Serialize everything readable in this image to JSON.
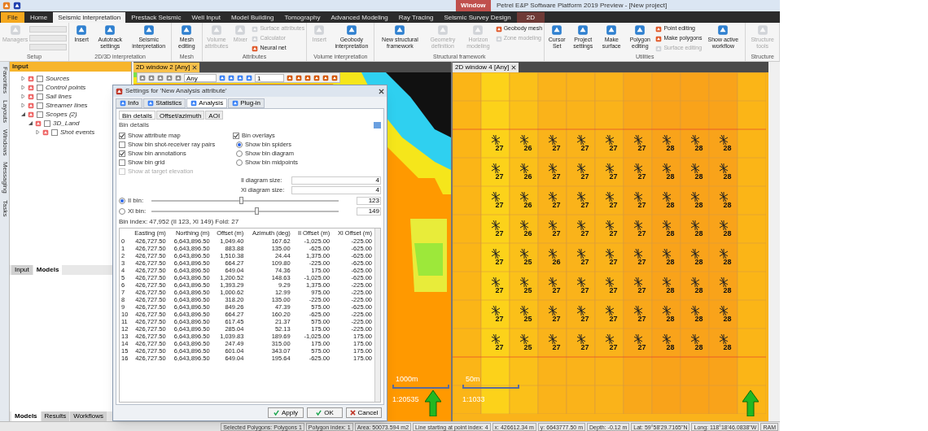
{
  "title_bar": {
    "title": "Petrel E&P Software Platform 2019 Preview - [New project]",
    "context_label": "Window"
  },
  "menu_tabs": [
    {
      "label": "File",
      "selected": false,
      "kind": "file"
    },
    {
      "label": "Home",
      "selected": false,
      "kind": "tab"
    },
    {
      "label": "Seismic interpretation",
      "selected": true,
      "kind": "tab"
    },
    {
      "label": "Prestack Seismic",
      "selected": false,
      "kind": "tab"
    },
    {
      "label": "Well Input",
      "selected": false,
      "kind": "tab"
    },
    {
      "label": "Model Building",
      "selected": false,
      "kind": "tab"
    },
    {
      "label": "Tomography",
      "selected": false,
      "kind": "tab"
    },
    {
      "label": "Advanced Modeling",
      "selected": false,
      "kind": "tab"
    },
    {
      "label": "Ray Tracing",
      "selected": false,
      "kind": "tab"
    },
    {
      "label": "Seismic Survey Design",
      "selected": false,
      "kind": "tab"
    },
    {
      "label": "2D",
      "selected": false,
      "kind": "context"
    }
  ],
  "ribbon_groups": [
    {
      "label": "Setup",
      "items": [
        {
          "kind": "large",
          "label": "Managers",
          "disabled": true
        },
        {
          "kind": "combos"
        }
      ]
    },
    {
      "label": "2D/3D interpretation",
      "items": [
        {
          "kind": "large",
          "label": "Insert",
          "disabled": false
        },
        {
          "kind": "large",
          "label": "Autotrack settings",
          "disabled": false
        },
        {
          "kind": "large",
          "label": "Seismic interpretation",
          "disabled": false
        }
      ]
    },
    {
      "label": "Mesh",
      "items": [
        {
          "kind": "large",
          "label": "Mesh editing",
          "disabled": false
        }
      ]
    },
    {
      "label": "Attributes",
      "items": [
        {
          "kind": "large",
          "label": "Volume attributes",
          "disabled": true
        },
        {
          "kind": "large",
          "label": "Mixer",
          "disabled": true
        },
        {
          "kind": "small",
          "label": "Surface attributes",
          "disabled": true
        },
        {
          "kind": "small",
          "label": "Calculator",
          "disabled": true
        },
        {
          "kind": "small",
          "label": "Neural net",
          "disabled": false
        }
      ]
    },
    {
      "label": "Volume interpretation",
      "items": [
        {
          "kind": "large",
          "label": "Insert",
          "disabled": true
        },
        {
          "kind": "large",
          "label": "Geobody interpretation",
          "disabled": false
        }
      ]
    },
    {
      "label": "Structural framework",
      "items": [
        {
          "kind": "large",
          "label": "New structural framework",
          "disabled": false
        },
        {
          "kind": "large",
          "label": "Geometry definition",
          "disabled": true
        },
        {
          "kind": "large",
          "label": "Horizon modeling",
          "disabled": true
        },
        {
          "kind": "small",
          "label": "Geobody mesh",
          "disabled": false
        },
        {
          "kind": "small",
          "label": "Zone modeling",
          "disabled": true
        }
      ]
    },
    {
      "label": "Utilities",
      "items": [
        {
          "kind": "large",
          "label": "Cursor Set",
          "disabled": false
        },
        {
          "kind": "large",
          "label": "Project settings",
          "disabled": false
        },
        {
          "kind": "large",
          "label": "Make surface",
          "disabled": false
        },
        {
          "kind": "large",
          "label": "Polygon editing",
          "disabled": false
        },
        {
          "kind": "small",
          "label": "Point editing",
          "disabled": false
        },
        {
          "kind": "small",
          "label": "Make polygons",
          "disabled": false
        },
        {
          "kind": "small",
          "label": "Surface editing",
          "disabled": true
        },
        {
          "kind": "large",
          "label": "Show active workflow",
          "disabled": false
        }
      ]
    },
    {
      "label": "Structure",
      "items": [
        {
          "kind": "large",
          "label": "Structure tools",
          "disabled": true
        }
      ]
    }
  ],
  "sidebar_strip": [
    "Favorites",
    "Layouts",
    "Windows",
    "Messaging",
    "Tasks"
  ],
  "input_panel": {
    "title": "Input",
    "tree": [
      {
        "label": "Sources",
        "expanded": false,
        "checked": false
      },
      {
        "label": "Control points",
        "expanded": false,
        "checked": false
      },
      {
        "label": "Sail lines",
        "expanded": false,
        "checked": false
      },
      {
        "label": "Streamer lines",
        "expanded": false,
        "checked": false
      },
      {
        "label": "Scopes (2)",
        "expanded": true,
        "checked": false,
        "children": [
          {
            "label": "3D_Land",
            "expanded": true,
            "checked": false,
            "children": [
              {
                "label": "Shot events",
                "expanded": false,
                "checked": false
              }
            ]
          }
        ]
      }
    ]
  },
  "panel_tabs": [
    {
      "label": "Input",
      "selected": false
    },
    {
      "label": "Models",
      "selected": true
    }
  ],
  "bottom_tabs": [
    {
      "label": "Models",
      "selected": true
    },
    {
      "label": "Results",
      "selected": false
    },
    {
      "label": "Workflows",
      "selected": false
    }
  ],
  "windows": [
    {
      "title": "2D window 2 [Any]",
      "selected": true,
      "domain": "Any",
      "zoom": "1",
      "scale_bar": "1000m",
      "scale": "1:20535"
    },
    {
      "title": "2D window 4 [Any]",
      "selected": false,
      "scale_bar": "50m",
      "scale": "1:1033",
      "bin_labels": [
        [
          "27",
          "26",
          "27",
          "27",
          "27",
          "27",
          "28",
          "28",
          "28"
        ],
        [
          "27",
          "26",
          "27",
          "27",
          "27",
          "27",
          "28",
          "28",
          "28"
        ],
        [
          "27",
          "26",
          "27",
          "27",
          "27",
          "27",
          "28",
          "28",
          "28"
        ],
        [
          "27",
          "26",
          "27",
          "27",
          "27",
          "27",
          "28",
          "28",
          "28"
        ],
        [
          "27",
          "25",
          "26",
          "27",
          "27",
          "27",
          "28",
          "28",
          "28"
        ],
        [
          "27",
          "25",
          "27",
          "27",
          "27",
          "27",
          "28",
          "28",
          "28"
        ],
        [
          "27",
          "25",
          "27",
          "27",
          "27",
          "27",
          "28",
          "28",
          "28"
        ],
        [
          "27",
          "25",
          "27",
          "27",
          "27",
          "27",
          "28",
          "28",
          "28"
        ]
      ]
    }
  ],
  "dialog": {
    "title": "Settings for 'New Analysis attribute'",
    "tabs": [
      {
        "label": "Info",
        "selected": false
      },
      {
        "label": "Statistics",
        "selected": false
      },
      {
        "label": "Analysis",
        "selected": true
      },
      {
        "label": "Plug-in",
        "selected": false
      }
    ],
    "subtabs": [
      {
        "label": "Bin details",
        "selected": true
      },
      {
        "label": "Offset/azimuth",
        "selected": false
      },
      {
        "label": "AOI",
        "selected": false
      }
    ],
    "section": "Bin details",
    "checkboxes": [
      {
        "label": "Show attribute map",
        "checked": true,
        "disabled": false
      },
      {
        "label": "Show bin shot-receiver ray pairs",
        "checked": false,
        "disabled": false
      },
      {
        "label": "Show bin annotations",
        "checked": true,
        "disabled": false
      },
      {
        "label": "Show bin grid",
        "checked": false,
        "disabled": false
      },
      {
        "label": "Show at target elevation",
        "checked": false,
        "disabled": true
      }
    ],
    "overlays": {
      "label": "Bin overlays",
      "checked": true
    },
    "radios": [
      {
        "label": "Show bin spiders",
        "selected": true
      },
      {
        "label": "Show bin diagram",
        "selected": false
      },
      {
        "label": "Show bin midpoints",
        "selected": false
      }
    ],
    "fields": [
      {
        "label": "Il diagram size:",
        "value": "4"
      },
      {
        "label": "Xl diagram size:",
        "value": "4"
      }
    ],
    "sliders": [
      {
        "label": "Il bin:",
        "selected": true,
        "level": 0.47,
        "value": "123"
      },
      {
        "label": "Xl bin:",
        "selected": false,
        "level": 0.55,
        "value": "149"
      }
    ],
    "bin_index": "Bin index: 47,952 (Il 123, Xl 149) Fold: 27",
    "table": {
      "columns": [
        "Easting (m)",
        "Northing (m)",
        "Offset (m)",
        "Azimuth (deg)",
        "Il Offset (m)",
        "Xl Offset (m)"
      ],
      "rows": [
        {
          "index": "0",
          "cells": [
            "426,727.50",
            "6,643,896.50",
            "1,049.40",
            "167.62",
            "-1,025.00",
            "-225.00"
          ]
        },
        {
          "index": "1",
          "cells": [
            "426,727.50",
            "6,643,896.50",
            "883.88",
            "135.00",
            "-625.00",
            "-625.00"
          ]
        },
        {
          "index": "2",
          "cells": [
            "426,727.50",
            "6,643,896.50",
            "1,510.38",
            "24.44",
            "1,375.00",
            "-625.00"
          ]
        },
        {
          "index": "3",
          "cells": [
            "426,727.50",
            "6,643,896.50",
            "664.27",
            "109.80",
            "-225.00",
            "-625.00"
          ]
        },
        {
          "index": "4",
          "cells": [
            "426,727.50",
            "6,643,896.50",
            "649.04",
            "74.36",
            "175.00",
            "-625.00"
          ]
        },
        {
          "index": "5",
          "cells": [
            "426,727.50",
            "6,643,896.50",
            "1,200.52",
            "148.63",
            "-1,025.00",
            "-625.00"
          ]
        },
        {
          "index": "6",
          "cells": [
            "426,727.50",
            "6,643,896.50",
            "1,393.29",
            "9.29",
            "1,375.00",
            "-225.00"
          ]
        },
        {
          "index": "7",
          "cells": [
            "426,727.50",
            "6,643,896.50",
            "1,000.62",
            "12.99",
            "975.00",
            "-225.00"
          ]
        },
        {
          "index": "8",
          "cells": [
            "426,727.50",
            "6,643,896.50",
            "318.20",
            "135.00",
            "-225.00",
            "-225.00"
          ]
        },
        {
          "index": "9",
          "cells": [
            "426,727.50",
            "6,643,896.50",
            "849.26",
            "47.39",
            "575.00",
            "-625.00"
          ]
        },
        {
          "index": "10",
          "cells": [
            "426,727.50",
            "6,643,896.50",
            "664.27",
            "160.20",
            "-625.00",
            "-225.00"
          ]
        },
        {
          "index": "11",
          "cells": [
            "426,727.50",
            "6,643,896.50",
            "617.45",
            "21.37",
            "575.00",
            "-225.00"
          ]
        },
        {
          "index": "12",
          "cells": [
            "426,727.50",
            "6,643,896.50",
            "285.04",
            "52.13",
            "175.00",
            "-225.00"
          ]
        },
        {
          "index": "13",
          "cells": [
            "426,727.50",
            "6,643,896.50",
            "1,039.83",
            "189.69",
            "-1,025.00",
            "175.00"
          ]
        },
        {
          "index": "14",
          "cells": [
            "426,727.50",
            "6,643,896.50",
            "247.49",
            "315.00",
            "175.00",
            "175.00"
          ]
        },
        {
          "index": "15",
          "cells": [
            "426,727.50",
            "6,643,896.50",
            "601.04",
            "343.07",
            "575.00",
            "175.00"
          ]
        },
        {
          "index": "16",
          "cells": [
            "426,727.50",
            "6,643,896.50",
            "649.04",
            "195.64",
            "-625.00",
            "175.00"
          ]
        }
      ]
    },
    "buttons": [
      {
        "label": "Apply",
        "kind": "ok"
      },
      {
        "label": "OK",
        "kind": "ok"
      },
      {
        "label": "Cancel",
        "kind": "cancel"
      }
    ]
  },
  "status_bar": [
    "Selected Polygons: Polygons 1",
    "Polygon index: 1",
    "Area: 50073.594 m2",
    "Line starting at point index: 4",
    "x: 426612.34 m",
    "y: 6643777.50 m",
    "Depth: -0.12 m",
    "Lat: 59°58'29.7165\"N",
    "Long: 118°18'46.0838\"W",
    "RAM"
  ]
}
